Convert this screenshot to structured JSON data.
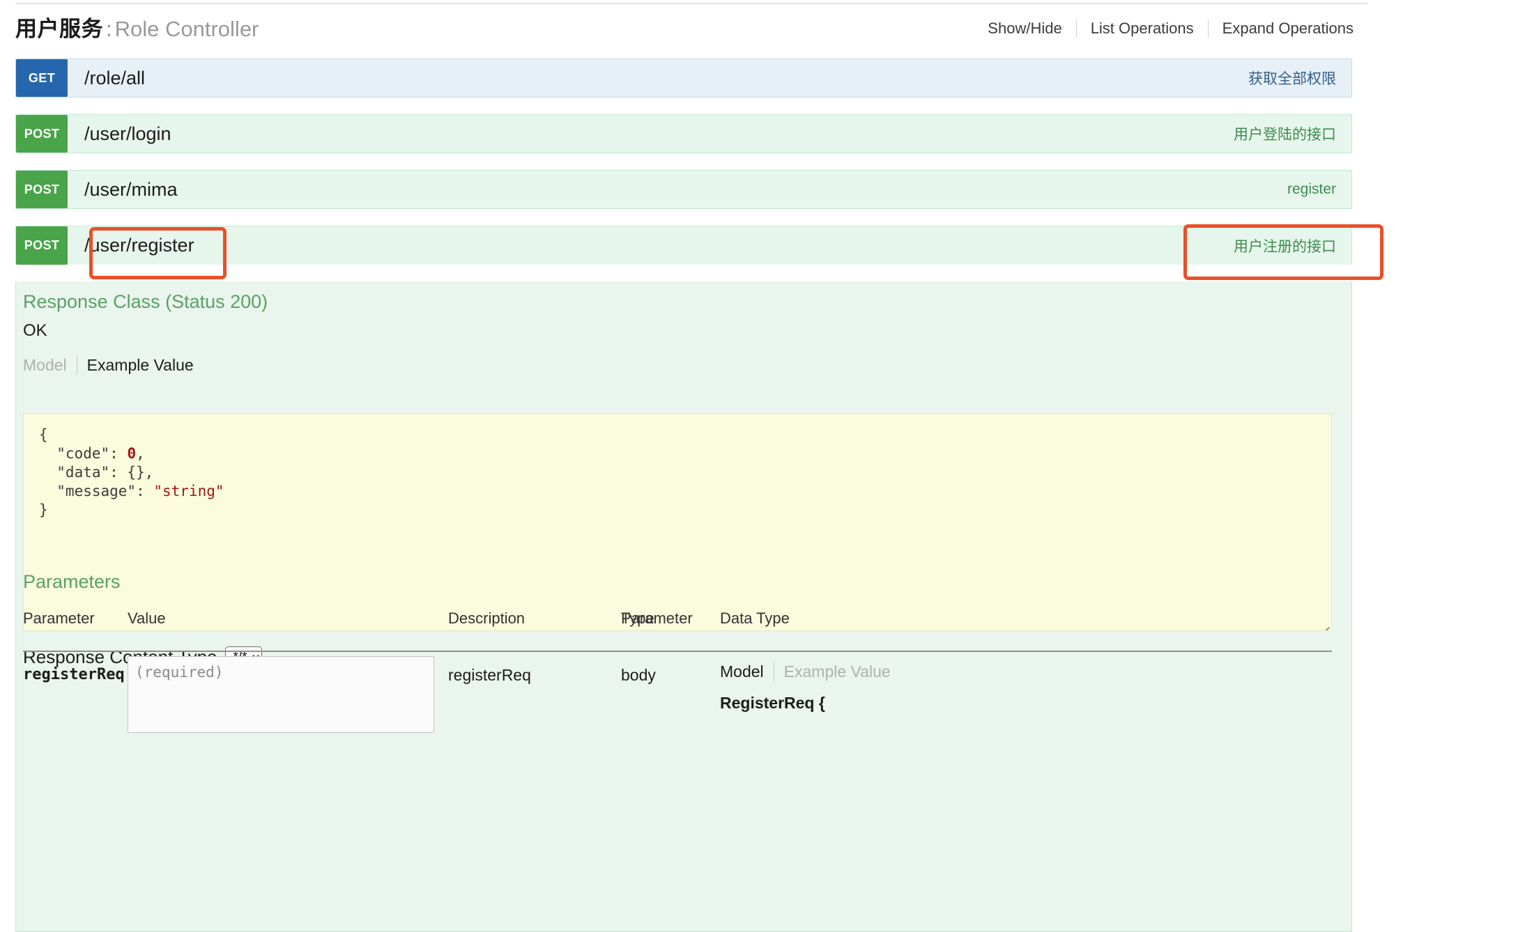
{
  "resource": {
    "title_cn": "用户服务",
    "title_separator": ":",
    "title_en": "Role Controller",
    "options": [
      {
        "label": "Show/Hide"
      },
      {
        "label": "List Operations"
      },
      {
        "label": "Expand Operations"
      }
    ]
  },
  "operations": [
    {
      "method": "GET",
      "path": "/role/all",
      "description": "获取全部权限"
    },
    {
      "method": "POST",
      "path": "/user/login",
      "description": "用户登陆的接口"
    },
    {
      "method": "POST",
      "path": "/user/mima",
      "description": "register"
    },
    {
      "method": "POST",
      "path": "/user/register",
      "description": "用户注册的接口"
    }
  ],
  "expanded": {
    "response_class_title": "Response Class (Status 200)",
    "response_status_text": "OK",
    "view_tabs": {
      "model": "Model",
      "example": "Example Value"
    },
    "example_value": {
      "line_open": "{",
      "fields": [
        {
          "key": "\"code\"",
          "value": "0",
          "type": "num",
          "comma": ","
        },
        {
          "key": "\"data\"",
          "value": "{}",
          "type": "plain",
          "comma": ","
        },
        {
          "key": "\"message\"",
          "value": "\"string\"",
          "type": "str",
          "comma": ""
        }
      ],
      "line_close": "}"
    },
    "response_content_type_label": "Response Content Type",
    "response_content_type_value": "*/*",
    "response_content_type_options": [
      "*/*"
    ],
    "parameters_title": "Parameters",
    "parameters_table": {
      "headers": {
        "parameter": "Parameter",
        "value": "Value",
        "description": "Description",
        "parameter_type_line1": "Parameter",
        "parameter_type_line2": "Type",
        "data_type": "Data Type"
      },
      "rows": [
        {
          "parameter": "registerReq",
          "value": "",
          "value_placeholder": "(required)",
          "description": "registerReq",
          "parameter_type": "body",
          "data_type_model_tab": "Model",
          "data_type_example_tab": "Example Value",
          "data_type_model_name": "RegisterReq {"
        }
      ]
    }
  },
  "annotations": {
    "color": "#e8502a",
    "boxes": [
      {
        "name": "path-highlight",
        "target": "/user/register"
      },
      {
        "name": "description-highlight",
        "target": "用户注册的接口"
      }
    ]
  },
  "colors": {
    "get_badge": "#2566ac",
    "post_badge": "#4aa44a",
    "get_row_bg": "#e7f0f7",
    "post_row_bg": "#e7f6ec",
    "expanded_bg": "#e9f5ed",
    "example_bg": "#fbfbdd",
    "section_green": "#5aa165",
    "annotation": "#e8502a"
  }
}
